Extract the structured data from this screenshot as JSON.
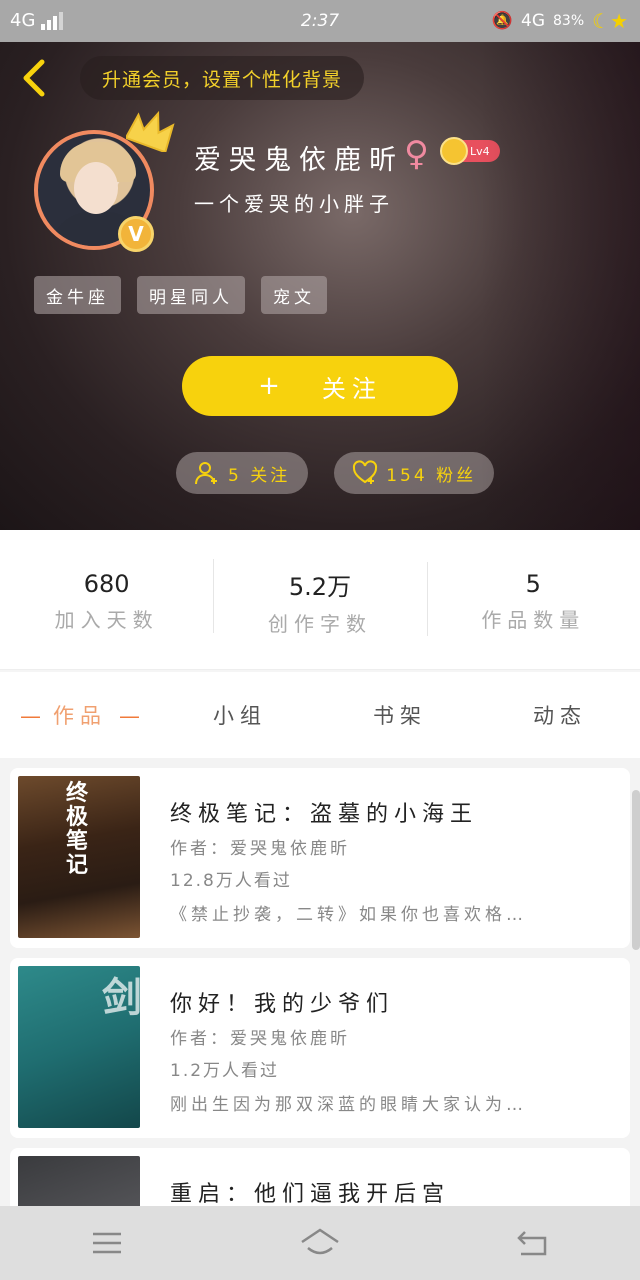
{
  "status_bar": {
    "network": "4G",
    "time": "2:37",
    "network_right": "4G",
    "battery": "83%"
  },
  "header": {
    "back_icon": "chevron-left-icon",
    "background_hint": "升通会员，设置个性化背景",
    "username": "爱哭鬼依鹿昕",
    "gender_symbol": "♀",
    "level": "Lv4",
    "vip_badge": "V",
    "signature": "一个爱哭的小胖子",
    "tags": [
      "金牛座",
      "明星同人",
      "宠文"
    ],
    "follow_plus": "+",
    "follow_label": "关注",
    "following": "5 关注",
    "fans": "154 粉丝"
  },
  "stats": [
    {
      "value": "680",
      "label": "加入天数"
    },
    {
      "value": "5.2万",
      "label": "创作字数"
    },
    {
      "value": "5",
      "label": "作品数量"
    }
  ],
  "tabs": [
    {
      "label": "作品",
      "active": true
    },
    {
      "label": "小组",
      "active": false
    },
    {
      "label": "书架",
      "active": false
    },
    {
      "label": "动态",
      "active": false
    }
  ],
  "books": [
    {
      "title": "终极笔记：盗墓的小海王",
      "author": "作者：爱哭鬼依鹿昕",
      "views": "12.8万人看过",
      "desc": "《禁止抄袭，二转》如果你也喜欢格…",
      "cover_text": "终极笔记"
    },
    {
      "title": "你好！我的少爷们",
      "author": "作者：爱哭鬼依鹿昕",
      "views": "1.2万人看过",
      "desc": "刚出生因为那双深蓝的眼睛大家认为…",
      "cover_text": "剑"
    },
    {
      "title": "重启：他们逼我开后宫",
      "author": "",
      "views": "",
      "desc": "",
      "cover_text": ""
    }
  ],
  "colors": {
    "accent_yellow": "#f7d20d",
    "tab_active": "#f0a070",
    "gender_pink": "#f08aa0",
    "level_red": "#e8505e"
  },
  "nav": {
    "menu_icon": "menu-icon",
    "home_icon": "home-icon",
    "back_icon": "return-icon"
  }
}
